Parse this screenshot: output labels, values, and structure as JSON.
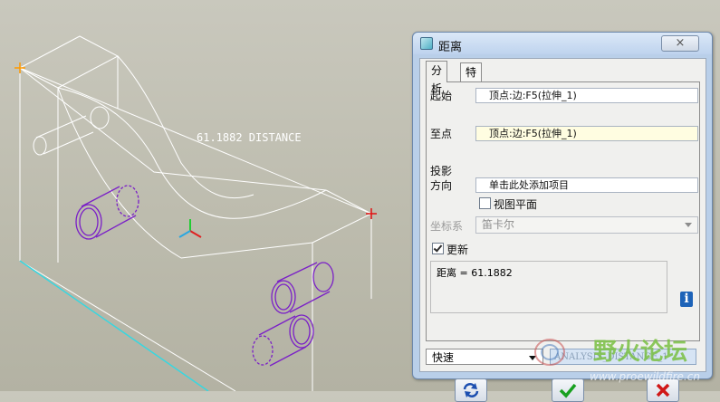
{
  "viewport": {
    "dimension_label": "61.1882  DISTANCE"
  },
  "dialog": {
    "title": "距离",
    "close_glyph": "×",
    "tabs": [
      {
        "label": "分析"
      },
      {
        "label": "特征"
      }
    ],
    "from": {
      "label": "起始",
      "value": "顶点:边:F5(拉伸_1)"
    },
    "to": {
      "label": "至点",
      "value": "顶点:边:F5(拉伸_1)"
    },
    "projection": {
      "label_line1": "投影",
      "label_line2": "方向",
      "placeholder": "单击此处添加项目"
    },
    "view_plane": {
      "label": "视图平面",
      "checked": false
    },
    "coord_system": {
      "label": "坐标系",
      "value": "笛卡尔"
    },
    "update": {
      "label": "更新",
      "checked": true
    },
    "result_text": "距离 = 61.1882",
    "info_icon": "info-icon",
    "speed_mode": "快速",
    "analysis_name": "ANALYSIS_DISTANCE_1"
  },
  "watermark": {
    "title": "野火论坛",
    "url": "www.proewildfire.cn"
  },
  "colors": {
    "dialog_frame": "#b9cfe9",
    "model_edges": "#ffffff",
    "hole_edges": "#7a1fc7",
    "marker_orange": "#ff9900",
    "marker_red": "#e01010",
    "datum_cyan": "#37d7e0"
  }
}
